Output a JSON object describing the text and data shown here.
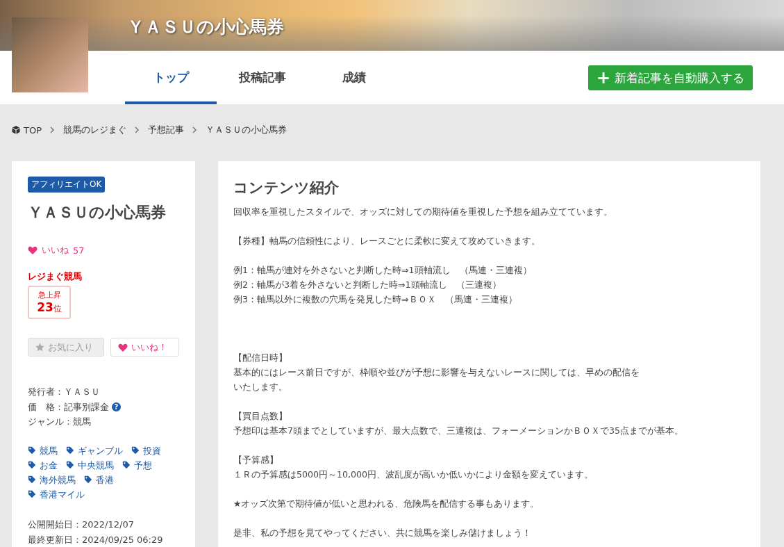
{
  "header": {
    "title": "ＹＡＳＵの小心馬券"
  },
  "tabs": [
    {
      "label": "トップ",
      "selected": true
    },
    {
      "label": "投稿記事",
      "selected": false
    },
    {
      "label": "成績",
      "selected": false
    }
  ],
  "auto_buy_button": {
    "icon": "+",
    "label": "新着記事を自動購入する"
  },
  "breadcrumb": [
    "TOP",
    "競馬のレジまぐ",
    "予想記事",
    "ＹＡＳＵの小心馬券"
  ],
  "profile": {
    "badge": "アフィリエイトOK",
    "title": "ＹＡＳＵの小心馬券",
    "likes_label": "いいね",
    "likes_count": "57",
    "ranking_site": "レジまぐ競馬",
    "rank_label": "急上昇",
    "rank_number": "23",
    "rank_suffix": "位",
    "favorite_button": {
      "label": "お気に入り",
      "disabled": true
    },
    "like_button": {
      "label": "いいね！",
      "disabled": false
    },
    "details": [
      {
        "text": "発行者：ＹＡＳＵ"
      },
      {
        "text": "価　格：記事別課金",
        "help": "?"
      },
      {
        "text": "ジャンル：競馬"
      }
    ],
    "tags": [
      [
        "競馬",
        "ギャンブル",
        "投資"
      ],
      [
        "お金",
        "中央競馬",
        "予想"
      ],
      [
        "海外競馬",
        "香港"
      ],
      [
        "香港マイル"
      ]
    ],
    "dates": [
      "公開開始日：2022/12/07",
      "最終更新日：2024/09/25 06:29"
    ]
  },
  "content": {
    "heading": "コンテンツ紹介",
    "blocks": [
      {
        "lines": [
          "回収率を重視したスタイルで、オッズに対しての期待値を重視した予想を組み立てています。"
        ]
      },
      {
        "lines": [
          "【券種】軸馬の信頼性により、レースごとに柔軟に変えて攻めていきます。"
        ]
      },
      {
        "lines": [
          "例1：軸馬が連対を外さないと判断した時⇒1頭軸流し　（馬連・三連複）",
          "例2：軸馬が3着を外さないと判断した時⇒1頭軸流し　（三連複）",
          "例3：軸馬以外に複数の穴馬を発見した時⇒ＢＯＸ　（馬連・三連複）"
        ]
      },
      {
        "lines": [
          "【配信日時】",
          "基本的にはレース前日ですが、枠順や並びが予想に影響を与えないレースに関しては、早めの配信を",
          "いたします。"
        ]
      },
      {
        "lines": [
          "【買目点数】",
          "予想印は基本7頭までとしていますが、最大点数で、三連複は、フォーメーションかＢＯＸで35点までが基本。"
        ]
      },
      {
        "lines": [
          "【予算感】",
          "１Ｒの予算感は5000円～10,000円、波乱度が高いか低いかにより金額を変えています。"
        ]
      },
      {
        "lines": [
          "★オッズ次第で期待値が低いと思われる、危険馬を配信する事もあります。"
        ]
      },
      {
        "lines": [
          "是非、私の予想を見てやってください、共に競馬を楽しみ儲けましょう！"
        ]
      }
    ]
  }
}
